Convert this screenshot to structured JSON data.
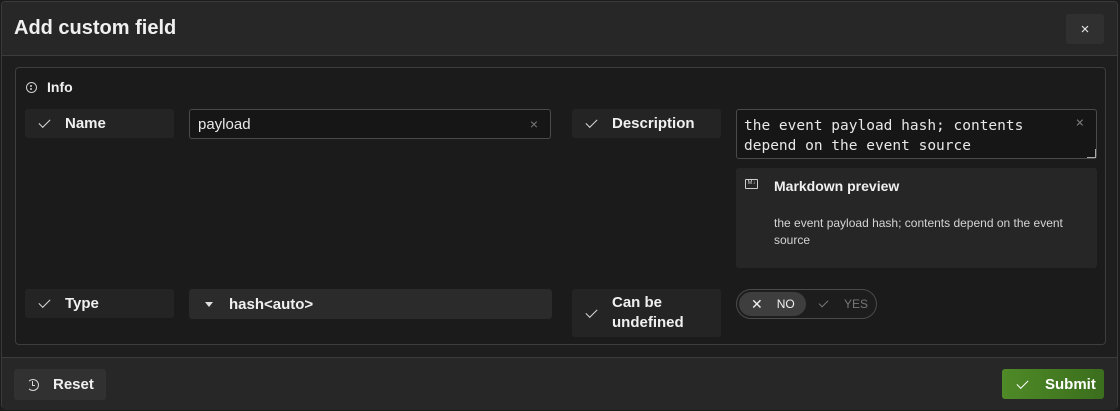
{
  "dialog": {
    "title": "Add custom field",
    "close_label": "×"
  },
  "section": {
    "title": "Info",
    "icon": "info-icon"
  },
  "fields": {
    "name": {
      "label": "Name",
      "value": "payload",
      "clear_label": "×"
    },
    "description": {
      "label": "Description",
      "value": "the event payload hash; contents depend on the event source",
      "clear_label": "×"
    },
    "markdown_preview": {
      "title": "Markdown preview",
      "icon_label": "M↓",
      "body": "the event payload hash; contents depend on the event source"
    },
    "type": {
      "label": "Type",
      "selected": "hash<auto>"
    },
    "undefined": {
      "label": "Can be undefined",
      "no_label": "NO",
      "yes_label": "YES",
      "value": "NO"
    }
  },
  "footer": {
    "reset_label": "Reset",
    "submit_label": "Submit"
  },
  "colors": {
    "background": "#1e1e1e",
    "submit_green": "#4f8a27"
  }
}
